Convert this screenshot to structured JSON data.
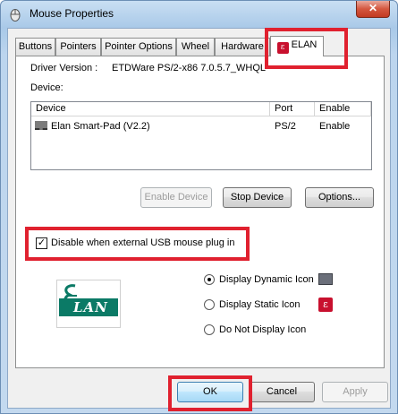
{
  "window": {
    "title": "Mouse Properties",
    "close_label": "✕"
  },
  "tabs": [
    {
      "label": "Buttons"
    },
    {
      "label": "Pointers"
    },
    {
      "label": "Pointer Options"
    },
    {
      "label": "Wheel"
    },
    {
      "label": "Hardware"
    },
    {
      "label": "ELAN",
      "active": true
    }
  ],
  "elan_panel": {
    "driver_version_label": "Driver Version :",
    "driver_version_value": "ETDWare PS/2-x86 7.0.5.7_WHQL",
    "device_label": "Device:",
    "device_table": {
      "headers": [
        "Device",
        "Port",
        "Enable"
      ],
      "rows": [
        {
          "device": "Elan Smart-Pad  (V2.2)",
          "port": "PS/2",
          "enable": "Enable"
        }
      ]
    },
    "buttons": {
      "enable_device": "Enable Device",
      "stop_device": "Stop Device",
      "options": "Options..."
    },
    "disable_usb_checkbox": {
      "label": "Disable when external USB mouse plug in",
      "checked": true
    },
    "logo_text": "LAN",
    "display_options": [
      {
        "label": "Display Dynamic Icon",
        "selected": true,
        "icon": "monitor-icon"
      },
      {
        "label": "Display Static Icon",
        "selected": false,
        "icon": "elan-icon"
      },
      {
        "label": "Do Not Display Icon",
        "selected": false
      }
    ]
  },
  "dialog_buttons": {
    "ok": "OK",
    "cancel": "Cancel",
    "apply": "Apply"
  },
  "colors": {
    "highlight": "#e0212f",
    "elan_red": "#c8102e",
    "elan_green": "#0b7a66"
  }
}
